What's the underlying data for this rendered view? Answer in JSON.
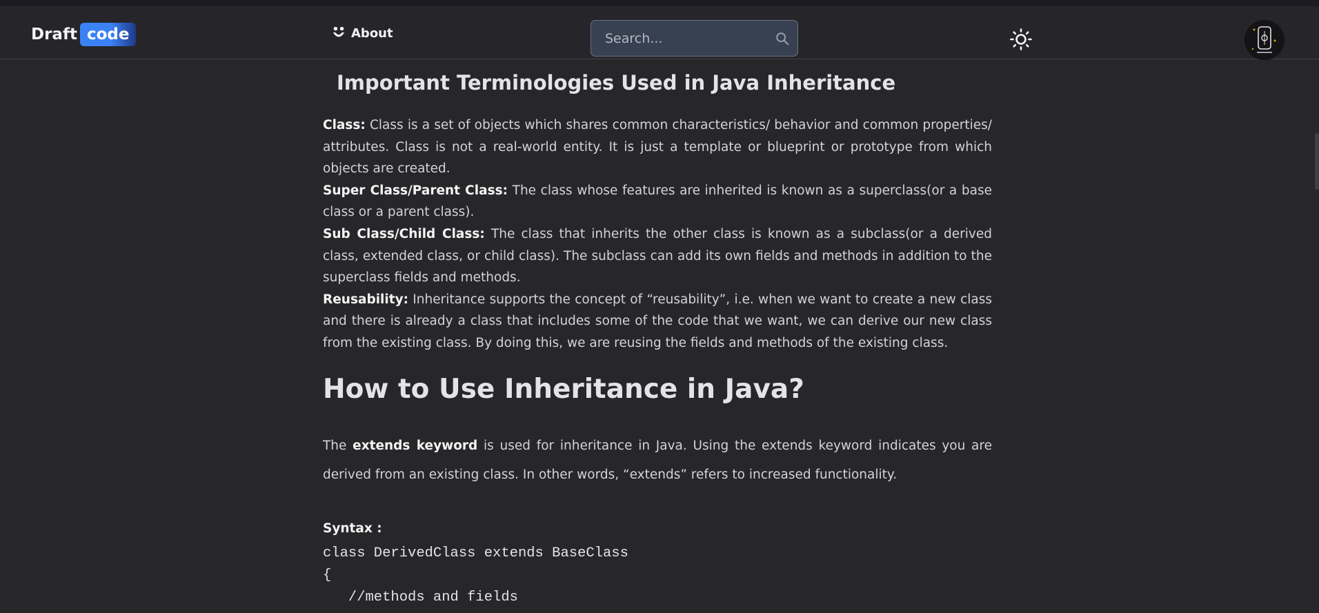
{
  "nav": {
    "logo_draft": "Draft",
    "logo_code": "code",
    "about_label": "About",
    "search_placeholder": "Search...",
    "theme_icon": "sun-icon",
    "avatar_icon": "profile-avatar"
  },
  "article": {
    "section_title": "Important Terminologies Used in Java Inheritance",
    "terms": [
      {
        "term": "Class:",
        "text": " Class is a set of objects which shares common characteristics/ behavior and common properties/ attributes. Class is not a real-world entity. It is just a template or blueprint or prototype from which objects are created."
      },
      {
        "term": "Super Class/Parent Class:",
        "text": " The class whose features are inherited is known as a superclass(or a base class or a parent class)."
      },
      {
        "term": "Sub Class/Child Class:",
        "text": " The class that inherits the other class is known as a subclass(or a derived class, extended class, or child class). The subclass can add its own fields and methods in addition to the superclass fields and methods."
      },
      {
        "term": "Reusability:",
        "text": " Inheritance supports the concept of “reusability”, i.e. when we want to create a new class and there is already a class that includes some of the code that we want, we can derive our new class from the existing class. By doing this, we are reusing the fields and methods of the existing class."
      }
    ],
    "heading": "How to Use Inheritance in Java?",
    "para_before": "The ",
    "para_bold": "extends keyword",
    "para_after": " is used for inheritance in Java. Using the extends keyword indicates you are derived from an existing class. In other words, “extends” refers to increased functionality.",
    "syntax_label": "Syntax :",
    "code_lines": [
      "class DerivedClass extends BaseClass",
      "{",
      "   //methods and fields"
    ]
  }
}
